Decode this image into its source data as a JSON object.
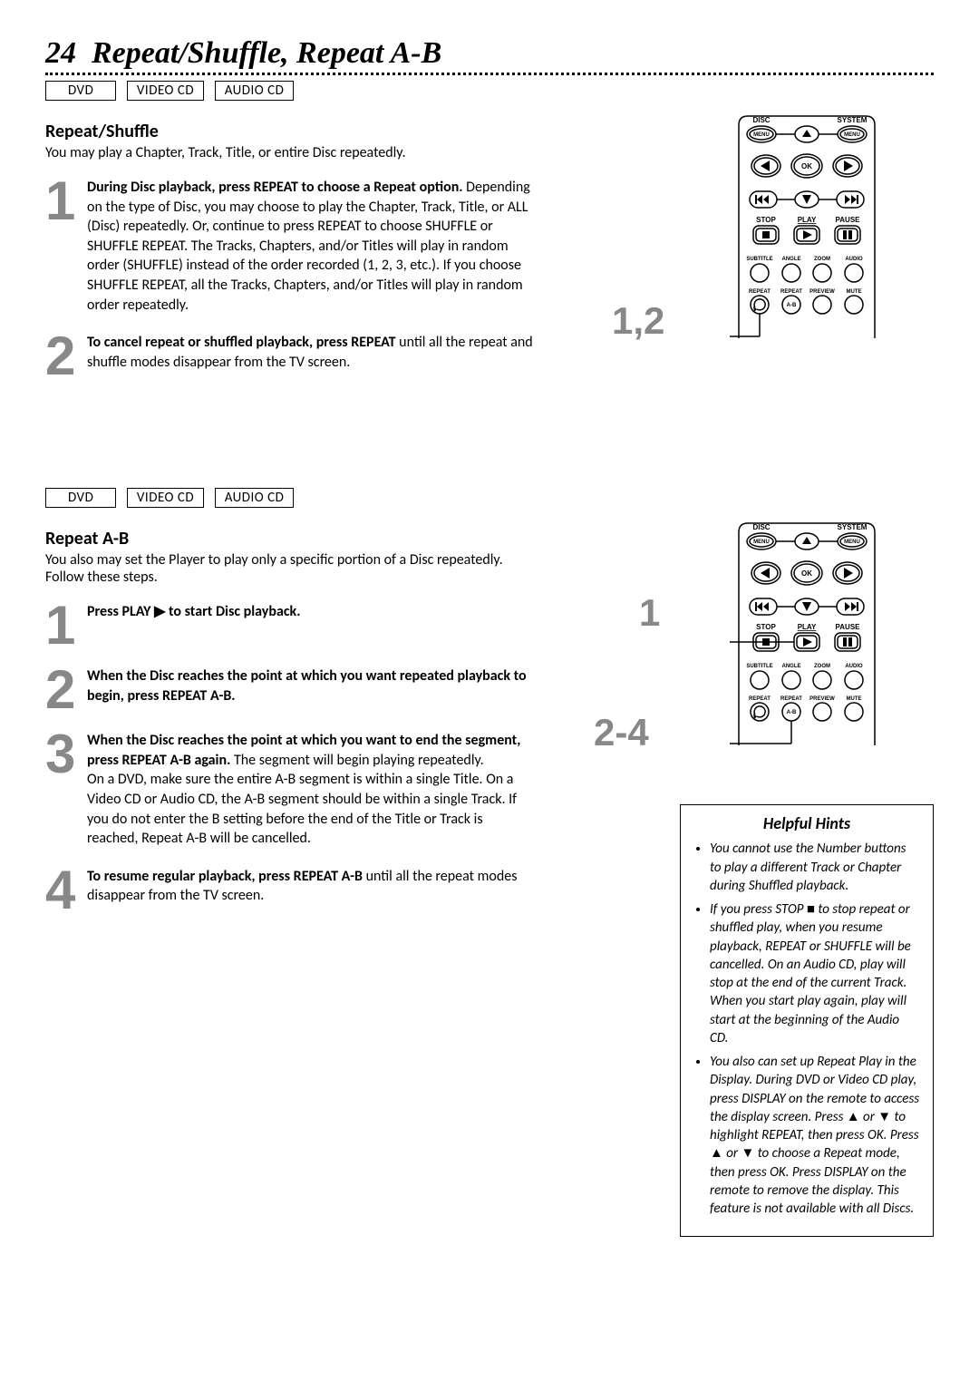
{
  "page": {
    "number": "24",
    "title": "Repeat/Shuffle, Repeat A-B",
    "badges": [
      "DVD",
      "VIDEO CD",
      "AUDIO CD"
    ]
  },
  "section1": {
    "title": "Repeat/Shuffle",
    "intro": "You may play a Chapter, Track, Title, or entire Disc repeatedly.",
    "steps": [
      {
        "num": "1",
        "bold": "During Disc playback, press REPEAT to choose a Repeat option.",
        "rest": " Depending on the type of Disc, you may choose to play the Chapter,  Track,  Title, or ALL (Disc) repeatedly. Or, continue to press REPEAT to choose SHUFFLE or SHUFFLE REPEAT. The Tracks, Chapters, and/or Titles will play in random order (SHUFFLE) instead of the order recorded (1, 2, 3, etc.). If you choose SHUFFLE REPEAT, all the Tracks, Chapters, and/or Titles will play in random order repeatedly."
      },
      {
        "num": "2",
        "bold": "To cancel repeat or shuffled playback, press REPEAT",
        "rest": " until all the repeat and shuffle modes disappear from the TV screen."
      }
    ],
    "remote_caption": "1,2"
  },
  "section2": {
    "title": "Repeat A-B",
    "intro": "You also may set the Player to play only a specific portion of a Disc repeatedly. Follow these steps.",
    "steps": [
      {
        "num": "1",
        "bold": "Press PLAY ▶ to start Disc playback.",
        "rest": ""
      },
      {
        "num": "2",
        "bold": "When the Disc reaches the point at which you want repeated playback to begin, press REPEAT A-B.",
        "rest": ""
      },
      {
        "num": "3",
        "bold": "When the Disc reaches the point at which you want to end the segment, press REPEAT A-B again.",
        "rest": " The segment will begin playing repeatedly.\nOn a DVD, make sure the entire A-B segment is within a single Title. On a Video CD or Audio CD, the A-B segment should be within a single Track. If you do not enter the B setting before the end of the Title or Track is reached, Repeat A-B will be cancelled."
      },
      {
        "num": "4",
        "bold": "To resume regular playback, press REPEAT A-B",
        "rest": " until all the repeat modes disappear from the TV screen."
      }
    ],
    "remote_caption_1": "1",
    "remote_caption_2": "2-4"
  },
  "hints": {
    "title": "Helpful Hints",
    "items": [
      "You cannot use the Number buttons to play a different Track or Chapter during Shuffled playback.",
      "If you press STOP ■ to stop repeat or shuffled play, when you resume playback, REPEAT or SHUFFLE will be cancelled. On an Audio CD, play will stop at the end of the current Track. When you start play again, play will start at the beginning of the Audio CD.",
      "You also can set up Repeat Play in the Display. During DVD or Video CD play, press DISPLAY on the remote to access the display screen. Press ▲ or ▼  to highlight REPEAT, then press OK. Press ▲ or ▼ to choose a Repeat mode, then press OK. Press DISPLAY on the remote to remove the display. This feature is not available with all Discs."
    ]
  },
  "remote_labels": {
    "disc": "DISC",
    "system": "SYSTEM",
    "menu": "MENU",
    "ok": "OK",
    "stop": "STOP",
    "play": "PLAY",
    "pause": "PAUSE",
    "subtitle": "SUBTITLE",
    "angle": "ANGLE",
    "zoom": "ZOOM",
    "audio": "AUDIO",
    "repeat": "REPEAT",
    "repeat_ab_lbl": "REPEAT",
    "ab": "A-B",
    "preview": "PREVIEW",
    "mute": "MUTE"
  }
}
